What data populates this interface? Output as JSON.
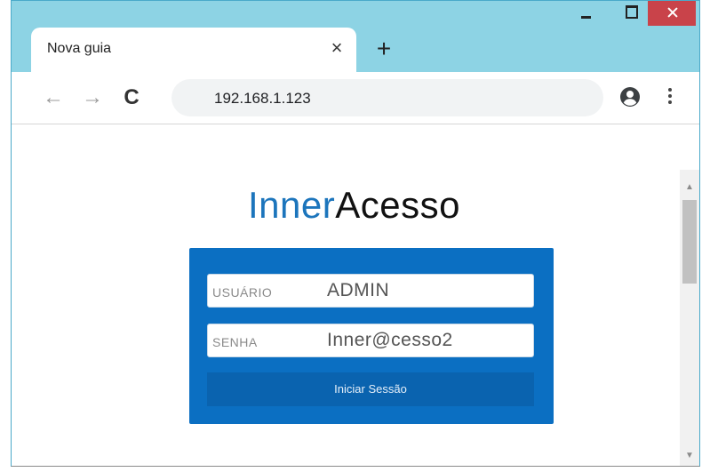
{
  "browser": {
    "tab": {
      "title": "Nova guia",
      "close_glyph": "×"
    },
    "new_tab_glyph": "+",
    "toolbar": {
      "back_glyph": "←",
      "forward_glyph": "→",
      "reload_glyph": "C",
      "address": "192.168.1.123"
    },
    "icons": {
      "back": "back-arrow-icon",
      "forward": "forward-arrow-icon",
      "reload": "reload-icon",
      "profile": "profile-icon",
      "menu": "kebab-menu-icon",
      "minimize": "minimize-icon",
      "maximize": "maximize-icon",
      "close": "close-icon"
    },
    "colors": {
      "tabstrip": "#8dd3e4",
      "close_button": "#c9434a"
    }
  },
  "page": {
    "brand": {
      "part1": "Inner",
      "part2": "Acesso"
    },
    "login": {
      "user_label": "USUÁRIO",
      "user_value": "ADMIN",
      "pass_label": "SENHA",
      "pass_value": "Inner@cesso2",
      "submit_label": "Iniciar Sessão"
    },
    "colors": {
      "brand_accent": "#1c75bc",
      "panel": "#0b6fc2",
      "button": "#0a63af"
    }
  }
}
